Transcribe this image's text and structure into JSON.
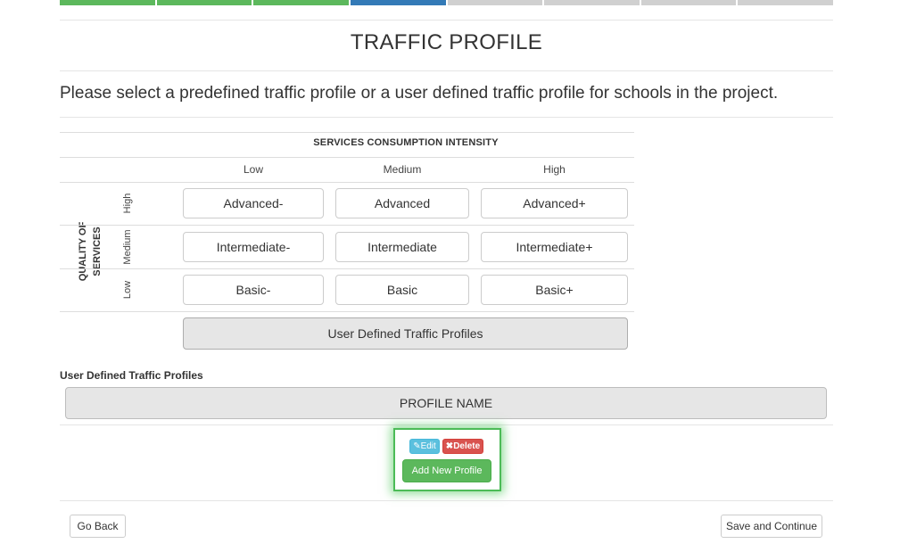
{
  "progress": {
    "colors": [
      "#5cb85c",
      "#5cb85c",
      "#5cb85c",
      "#337ab7",
      "#d0d0d0",
      "#d0d0d0",
      "#d0d0d0",
      "#d0d0d0"
    ]
  },
  "page": {
    "title": "TRAFFIC PROFILE",
    "instructions": "Please select a predefined traffic profile or a user defined traffic profile for schools in the project."
  },
  "matrix": {
    "header": "SERVICES CONSUMPTION INTENSITY",
    "columns": [
      "Low",
      "Medium",
      "High"
    ],
    "quality_label": "QUALITY OF SERVICES",
    "rows": [
      {
        "label": "High",
        "cells": [
          "Advanced-",
          "Advanced",
          "Advanced+"
        ]
      },
      {
        "label": "Medium",
        "cells": [
          "Intermediate-",
          "Intermediate",
          "Intermediate+"
        ]
      },
      {
        "label": "Low",
        "cells": [
          "Basic-",
          "Basic",
          "Basic+"
        ]
      }
    ],
    "user_defined_button": "User Defined Traffic Profiles"
  },
  "user_profiles": {
    "section_label": "User Defined Traffic Profiles",
    "table_header": "PROFILE NAME",
    "edit_label": "Edit",
    "delete_label": "Delete",
    "add_label": "Add New Profile"
  },
  "footer": {
    "back_label": "Go Back",
    "save_label": "Save and Continue"
  }
}
